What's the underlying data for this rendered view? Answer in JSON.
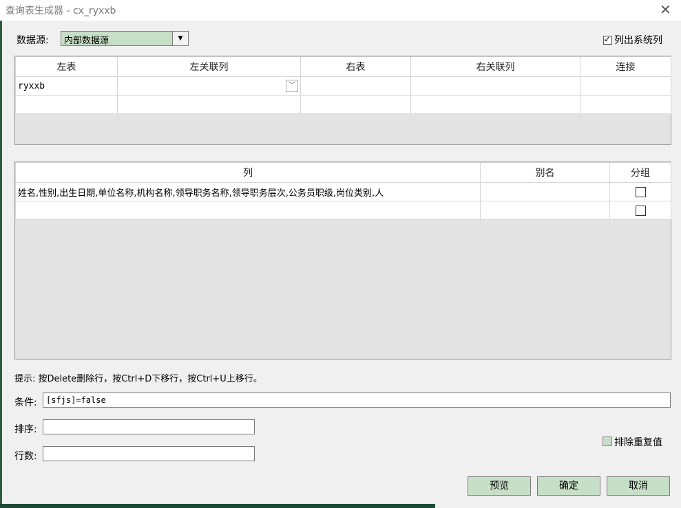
{
  "window": {
    "title": "查询表生成器 - cx_ryxxb",
    "close_icon": "close-icon"
  },
  "datasource": {
    "label": "数据源:",
    "value": "内部数据源",
    "dropdown_arrow": "▼"
  },
  "list_system_columns": {
    "label": "列出系统列",
    "checked": true
  },
  "join_table": {
    "headers": [
      "左表",
      "左关联列",
      "右表",
      "右关联列",
      "连接"
    ],
    "rows": [
      {
        "left_table": "ryxxb",
        "left_col": "",
        "right_table": "",
        "right_col": "",
        "join": ""
      },
      {
        "left_table": "",
        "left_col": "",
        "right_table": "",
        "right_col": "",
        "join": ""
      }
    ]
  },
  "columns_table": {
    "headers": [
      "列",
      "别名",
      "分组"
    ],
    "rows": [
      {
        "column": "姓名,性别,出生日期,单位名称,机构名称,领导职务名称,领导职务层次,公务员职级,岗位类别,人",
        "alias": "",
        "group": false
      },
      {
        "column": "",
        "alias": "",
        "group": false
      }
    ]
  },
  "hint": "提示: 按Delete删除行，按Ctrl+D下移行，按Ctrl+U上移行。",
  "condition": {
    "label": "条件:",
    "value": "[sfjs]=false"
  },
  "sort": {
    "label": "排序:",
    "value": ""
  },
  "rows_count": {
    "label": "行数:",
    "value": ""
  },
  "distinct": {
    "label": "排除重复值",
    "checked": false
  },
  "buttons": {
    "preview": "预览",
    "ok": "确定",
    "cancel": "取消"
  }
}
